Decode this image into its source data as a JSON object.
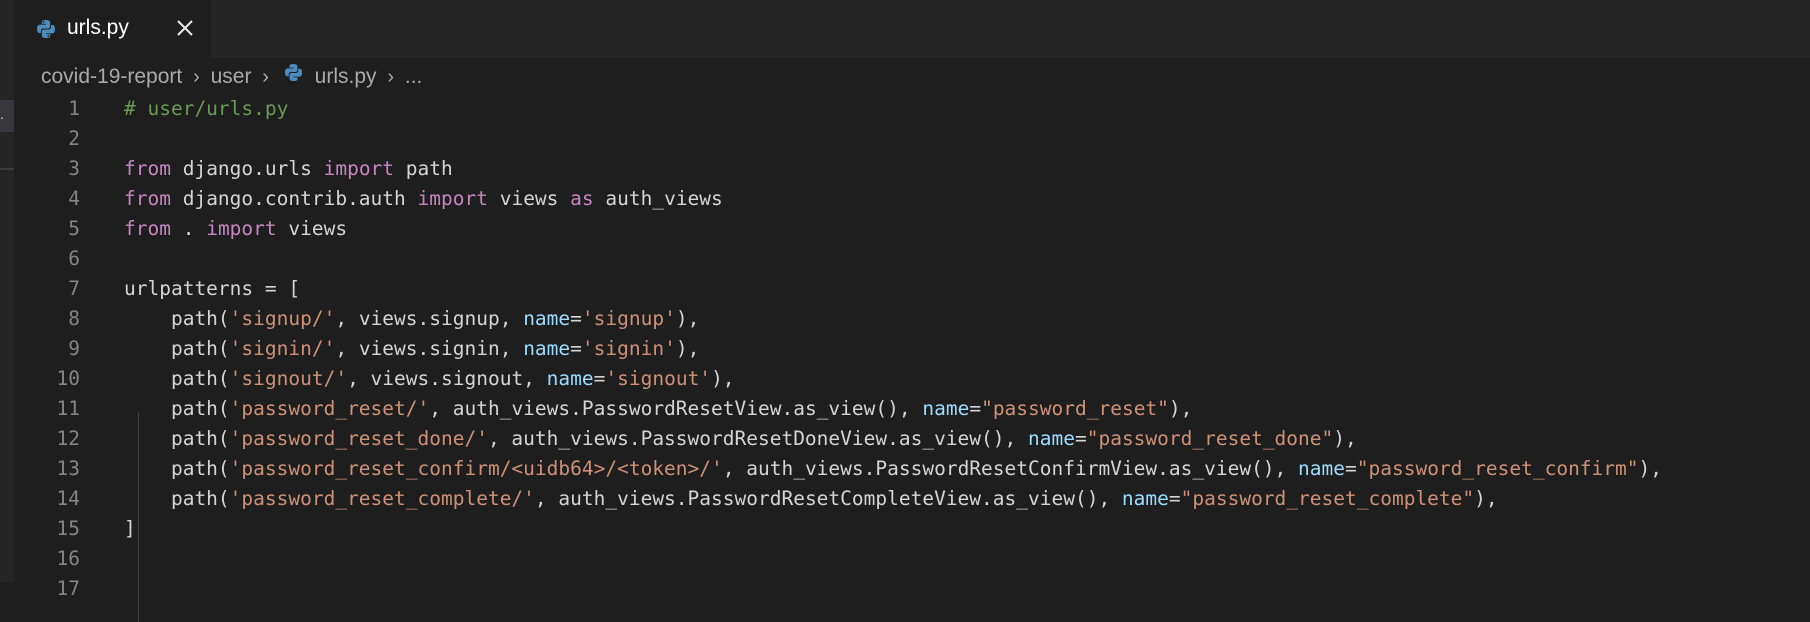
{
  "tab": {
    "filename": "urls.py"
  },
  "breadcrumb": {
    "root": "covid-19-report",
    "folder": "user",
    "file": "urls.py",
    "more": "..."
  },
  "colors": {
    "comment": "#6a9955",
    "keyword": "#c586c0",
    "string": "#ce9178",
    "parameter": "#9cdcfe",
    "text": "#d4d4d4",
    "line_number": "#858585",
    "python_icon_blue": "#4b8bbe"
  },
  "editor": {
    "lines": [
      {
        "n": "1",
        "t": [
          {
            "c": "comment",
            "s": "# user/urls.py"
          }
        ]
      },
      {
        "n": "2",
        "t": []
      },
      {
        "n": "3",
        "t": [
          {
            "c": "kw",
            "s": "from"
          },
          {
            "c": "",
            "s": " django.urls "
          },
          {
            "c": "kw",
            "s": "import"
          },
          {
            "c": "",
            "s": " path"
          }
        ]
      },
      {
        "n": "4",
        "t": [
          {
            "c": "kw",
            "s": "from"
          },
          {
            "c": "",
            "s": " django.contrib.auth "
          },
          {
            "c": "kw",
            "s": "import"
          },
          {
            "c": "",
            "s": " views "
          },
          {
            "c": "kw",
            "s": "as"
          },
          {
            "c": "",
            "s": " auth_views"
          }
        ]
      },
      {
        "n": "5",
        "t": [
          {
            "c": "kw",
            "s": "from"
          },
          {
            "c": "",
            "s": " . "
          },
          {
            "c": "kw",
            "s": "import"
          },
          {
            "c": "",
            "s": " views"
          }
        ]
      },
      {
        "n": "6",
        "t": []
      },
      {
        "n": "7",
        "t": [
          {
            "c": "",
            "s": "urlpatterns = ["
          }
        ]
      },
      {
        "n": "8",
        "t": [
          {
            "c": "",
            "s": "    path("
          },
          {
            "c": "str",
            "s": "'signup/'"
          },
          {
            "c": "",
            "s": ", views.signup, "
          },
          {
            "c": "param",
            "s": "name"
          },
          {
            "c": "",
            "s": "="
          },
          {
            "c": "str",
            "s": "'signup'"
          },
          {
            "c": "",
            "s": "),"
          }
        ]
      },
      {
        "n": "9",
        "t": [
          {
            "c": "",
            "s": "    path("
          },
          {
            "c": "str",
            "s": "'signin/'"
          },
          {
            "c": "",
            "s": ", views.signin, "
          },
          {
            "c": "param",
            "s": "name"
          },
          {
            "c": "",
            "s": "="
          },
          {
            "c": "str",
            "s": "'signin'"
          },
          {
            "c": "",
            "s": "),"
          }
        ]
      },
      {
        "n": "10",
        "t": [
          {
            "c": "",
            "s": "    path("
          },
          {
            "c": "str",
            "s": "'signout/'"
          },
          {
            "c": "",
            "s": ", views.signout, "
          },
          {
            "c": "param",
            "s": "name"
          },
          {
            "c": "",
            "s": "="
          },
          {
            "c": "str",
            "s": "'signout'"
          },
          {
            "c": "",
            "s": "),"
          }
        ]
      },
      {
        "n": "11",
        "t": [
          {
            "c": "",
            "s": "    path("
          },
          {
            "c": "str",
            "s": "'password_reset/'"
          },
          {
            "c": "",
            "s": ", auth_views.PasswordResetView.as_view(), "
          },
          {
            "c": "param",
            "s": "name"
          },
          {
            "c": "",
            "s": "="
          },
          {
            "c": "str",
            "s": "\"password_reset\""
          },
          {
            "c": "",
            "s": "),"
          }
        ]
      },
      {
        "n": "12",
        "t": [
          {
            "c": "",
            "s": "    path("
          },
          {
            "c": "str",
            "s": "'password_reset_done/'"
          },
          {
            "c": "",
            "s": ", auth_views.PasswordResetDoneView.as_view(), "
          },
          {
            "c": "param",
            "s": "name"
          },
          {
            "c": "",
            "s": "="
          },
          {
            "c": "str",
            "s": "\"password_reset_done\""
          },
          {
            "c": "",
            "s": "),"
          }
        ]
      },
      {
        "n": "13",
        "t": [
          {
            "c": "",
            "s": "    path("
          },
          {
            "c": "str",
            "s": "'password_reset_confirm/<uidb64>/<token>/'"
          },
          {
            "c": "",
            "s": ", auth_views.PasswordResetConfirmView.as_view(), "
          },
          {
            "c": "param",
            "s": "name"
          },
          {
            "c": "",
            "s": "="
          },
          {
            "c": "str",
            "s": "\"password_reset_confirm\""
          },
          {
            "c": "",
            "s": "),"
          }
        ]
      },
      {
        "n": "14",
        "t": [
          {
            "c": "",
            "s": "    path("
          },
          {
            "c": "str",
            "s": "'password_reset_complete/'"
          },
          {
            "c": "",
            "s": ", auth_views.PasswordResetCompleteView.as_view(), "
          },
          {
            "c": "param",
            "s": "name"
          },
          {
            "c": "",
            "s": "="
          },
          {
            "c": "str",
            "s": "\"password_reset_complete\""
          },
          {
            "c": "",
            "s": "),"
          }
        ]
      },
      {
        "n": "15",
        "t": [
          {
            "c": "",
            "s": "]"
          }
        ]
      },
      {
        "n": "16",
        "t": []
      },
      {
        "n": "17",
        "t": []
      }
    ]
  }
}
